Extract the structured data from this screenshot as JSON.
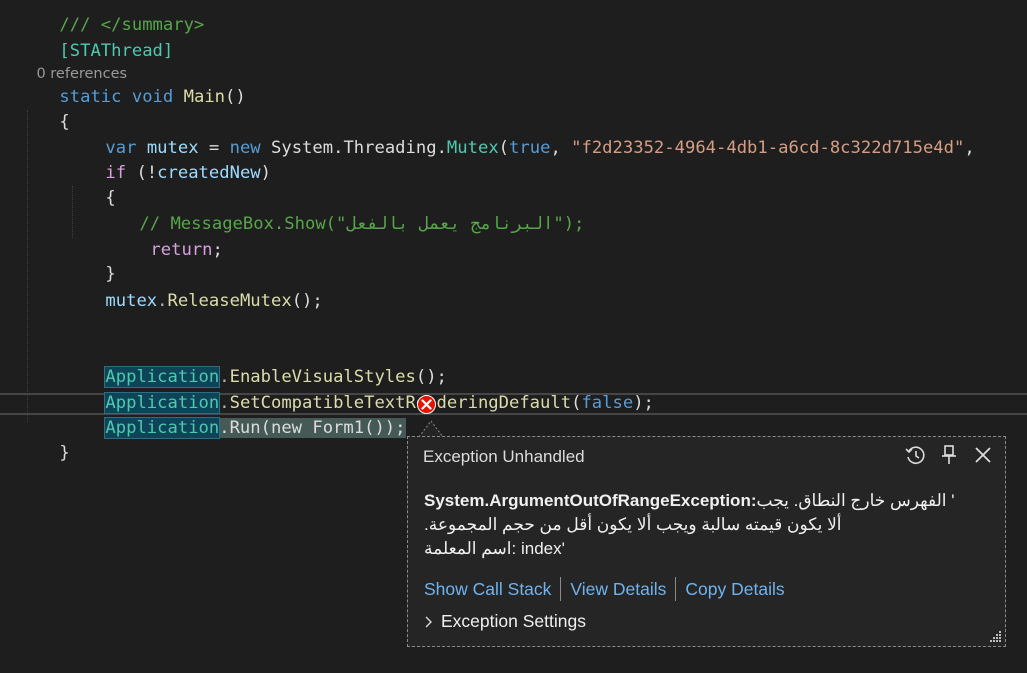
{
  "code": {
    "summary_comment": "/// </summary>",
    "attribute": "[STAThread]",
    "codelens": "0 references",
    "main_static": "static",
    "main_void": "void",
    "main_name": "Main",
    "main_parens": "()",
    "open_brace": "{",
    "line_mutex": {
      "var": "var",
      "name": "mutex",
      "eq": " = ",
      "new": "new",
      "ns": " System.Threading.",
      "type": "Mutex",
      "paren": "(",
      "true": "true",
      "comma": ", ",
      "guid": "\"f2d23352-4964-4db1-a6cd-8c322d715e4d\"",
      "tail": ", "
    },
    "line_if": {
      "if": "if",
      "rest_open": " (!",
      "var": "createdNew",
      "rest_close": ")"
    },
    "inner_open_brace": "{",
    "comment_msgbox": "// MessageBox.Show(\"البرنامج يعمل بالفعل\");",
    "return_kw": "return",
    "return_semi": ";",
    "inner_close_brace": "}",
    "release": {
      "var": "mutex",
      "dot": ".",
      "method": "ReleaseMutex",
      "rest": "();"
    },
    "enable_visual": {
      "type": "Application",
      "dot": ".",
      "method": "EnableVisualStyles",
      "rest": "();"
    },
    "set_compat": {
      "type": "Application",
      "dot": ".",
      "method": "SetCompatibleTextRenderingDefault",
      "open": "(",
      "false": "false",
      "close": ");"
    },
    "app_run": {
      "type": "Application",
      "rest": ".Run(new Form1());"
    },
    "close_brace": "}"
  },
  "exception": {
    "title": "Exception Unhandled",
    "type": "System.ArgumentOutOfRangeException:",
    "message_line1": " ' الفهرس خارج النطاق. يجب",
    "message_line2": ".ألا يكون قيمته سالبة ويجب ألا يكون أقل من حجم المجموعة",
    "message_line3": "اسم المعلمة: index'",
    "links": [
      "Show Call Stack",
      "View Details",
      "Copy Details"
    ],
    "settings_label": "Exception Settings",
    "icons": [
      "history-icon",
      "pin-icon",
      "close-icon"
    ]
  },
  "colors": {
    "background": "#1e1e1e",
    "error": "#e51400",
    "link": "#6fb3f0"
  }
}
